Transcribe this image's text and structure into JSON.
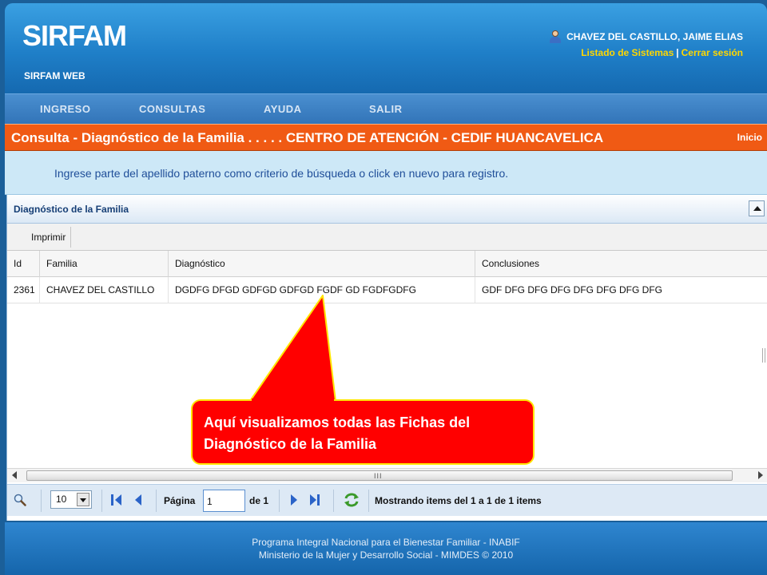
{
  "app": {
    "brand": "SIRFAM",
    "subtitle": "SIRFAM WEB"
  },
  "user": {
    "name": "CHAVEZ DEL CASTILLO, JAIME ELIAS",
    "systems_link": "Listado de Sistemas",
    "separator": "|",
    "logout_link": "Cerrar sesión"
  },
  "nav": {
    "items": [
      "INGRESO",
      "CONSULTAS",
      "AYUDA",
      "SALIR"
    ]
  },
  "title_bar": {
    "text": "Consulta - Diagnóstico de la Familia . . . . . CENTRO DE ATENCIÓN - CEDIF HUANCAVELICA",
    "home_link": "Inicio"
  },
  "info": {
    "text": "Ingrese parte del apellido paterno como criterio de búsqueda o click en nuevo para registro."
  },
  "panel": {
    "title": "Diagnóstico de la Familia",
    "print_button": "Imprimir"
  },
  "grid": {
    "columns": [
      "Id",
      "Familia",
      "Diagnóstico",
      "Conclusiones"
    ],
    "rows": [
      {
        "id": "2361",
        "familia": "CHAVEZ DEL CASTILLO",
        "diagnostico": "DGDFG DFGD GDFGD GDFGD FGDF GD FGDFGDFG",
        "conclusiones": "GDF DFG DFG DFG DFG DFG DFG DFG"
      }
    ],
    "scroll_grip": "III"
  },
  "pager": {
    "page_size": "10",
    "page_label": "Página",
    "current_page": "1",
    "of_label": "de 1",
    "status": "Mostrando items del 1 a 1 de 1 items"
  },
  "footer": {
    "line1": "Programa Integral Nacional para el Bienestar Familiar - INABIF",
    "line2": "Ministerio de la Mujer y Desarrollo Social - MIMDES © 2010"
  },
  "callout": {
    "text": "Aquí visualizamos todas las Fichas del\nDiagnóstico  de la  Familia"
  },
  "colors": {
    "header_blue": "#1f7fc8",
    "title_orange": "#f05a14",
    "link_yellow": "#ffd700",
    "callout_red": "#ff0000",
    "callout_border": "#ffe600"
  }
}
